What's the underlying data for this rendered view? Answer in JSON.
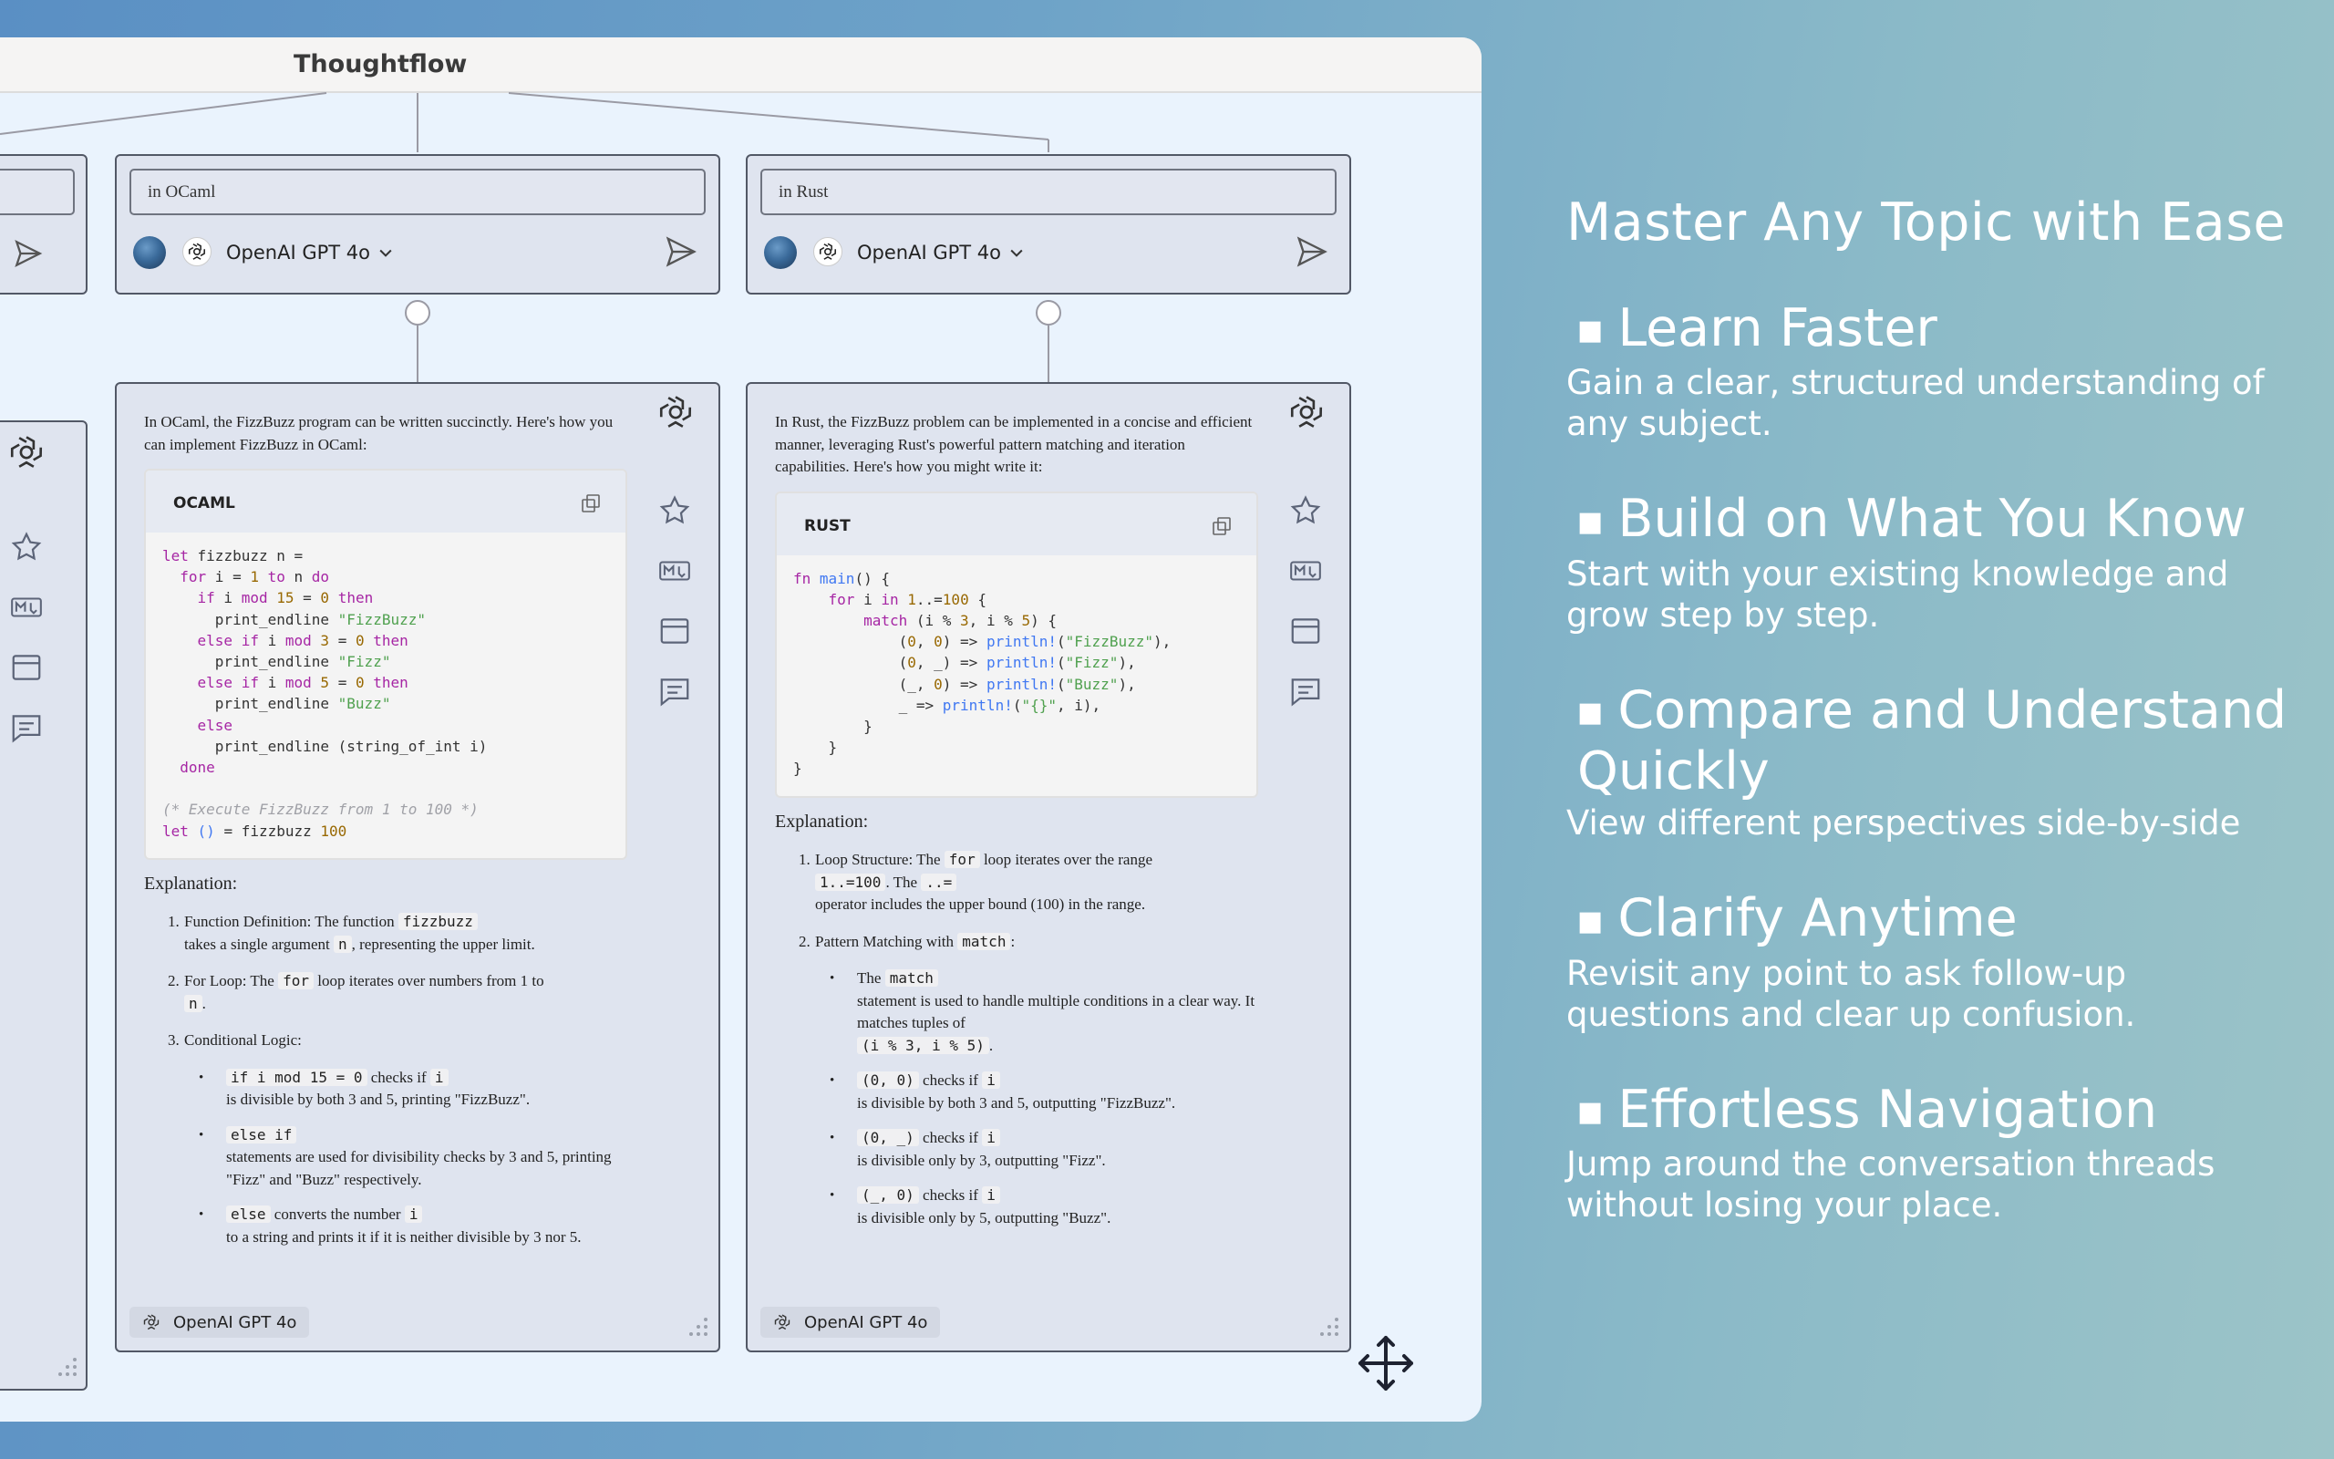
{
  "window": {
    "title": "Thoughtflow"
  },
  "columns": [
    {
      "prompt": "in OCaml",
      "model": "OpenAI GPT 4o",
      "intro": "In OCaml, the FizzBuzz program can be written succinctly. Here's how you can implement FizzBuzz in OCaml:",
      "code_lang": "OCAML",
      "explanation_title": "Explanation:",
      "items": [
        {
          "num": "1.",
          "pre": "Function Definition: The function ",
          "code": "fizzbuzz",
          "post": " takes a single argument ",
          "code2": "n",
          "post2": ", representing the upper limit."
        },
        {
          "num": "2.",
          "pre": "For Loop: The ",
          "code": "for",
          "post": " loop iterates over numbers from 1 to ",
          "code2": "n",
          "post2": "."
        },
        {
          "num": "3.",
          "pre": "Conditional Logic:",
          "code": "",
          "post": "",
          "code2": "",
          "post2": ""
        }
      ],
      "bullets": [
        {
          "code": "if i mod 15 = 0",
          "text": " checks if ",
          "code2": "i",
          "text2": " is divisible by both 3 and 5, printing \"FizzBuzz\"."
        },
        {
          "code": "else if",
          "text": " statements are used for divisibility checks by 3 and 5, printing \"Fizz\" and \"Buzz\" respectively.",
          "code2": "",
          "text2": ""
        },
        {
          "code": "else",
          "text": " converts the number ",
          "code2": "i",
          "text2": " to a string and prints it if it is neither divisible by 3 nor 5."
        }
      ],
      "footer_model": "OpenAI GPT 4o"
    },
    {
      "prompt": "in Rust",
      "model": "OpenAI GPT 4o",
      "intro": "In Rust, the FizzBuzz problem can be implemented in a concise and efficient manner, leveraging Rust's powerful pattern matching and iteration capabilities. Here's how you might write it:",
      "code_lang": "RUST",
      "explanation_title": "Explanation:",
      "items": [
        {
          "num": "1.",
          "pre": "Loop Structure: The ",
          "code": "for",
          "post": " loop iterates over the range ",
          "code2": "1..=100",
          "post2": ". The ",
          "code3": "..=",
          "post3": " operator includes the upper bound (100) in the range."
        },
        {
          "num": "2.",
          "pre": "Pattern Matching with ",
          "code": "match",
          "post": ":",
          "code2": "",
          "post2": "",
          "code3": "",
          "post3": ""
        }
      ],
      "bullets": [
        {
          "pre": "The ",
          "code": "match",
          "text": " statement is used to handle multiple conditions in a clear way. It matches tuples of ",
          "code2": "(i % 3, i % 5)",
          "text2": "."
        },
        {
          "pre": "",
          "code": "(0, 0)",
          "text": " checks if ",
          "code2": "i",
          "text2": " is divisible by both 3 and 5, outputting \"FizzBuzz\"."
        },
        {
          "pre": "",
          "code": "(0, _)",
          "text": " checks if ",
          "code2": "i",
          "text2": " is divisible only by 3, outputting \"Fizz\"."
        },
        {
          "pre": "",
          "code": "(_, 0)",
          "text": " checks if ",
          "code2": "i",
          "text2": " is divisible only by 5, outputting \"Buzz\"."
        }
      ],
      "footer_model": "OpenAI GPT 4o"
    }
  ],
  "marketing": {
    "title": "Master Any Topic with Ease",
    "features": [
      {
        "head": "Learn Faster",
        "desc": "Gain a clear, structured understanding of any subject."
      },
      {
        "head": "Build on What You Know",
        "desc": "Start with your existing knowledge and grow step by step."
      },
      {
        "head": "Compare and Understand Quickly",
        "desc": "View different perspectives side-by-side"
      },
      {
        "head": "Clarify Anytime",
        "desc": "Revisit any point to ask follow-up questions and clear up confusion."
      },
      {
        "head": "Effortless Navigation",
        "desc": "Jump around the conversation threads without losing your place."
      }
    ]
  },
  "icons": [
    "openai-icon",
    "send-icon",
    "chevron-down-icon",
    "copy-icon",
    "star-icon",
    "markdown-icon",
    "window-icon",
    "comment-icon",
    "resize-grip-icon",
    "move-icon"
  ]
}
